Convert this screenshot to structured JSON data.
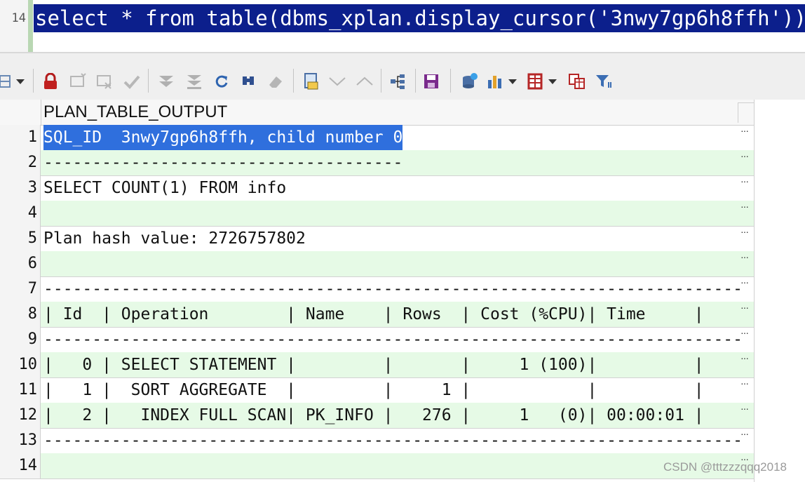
{
  "editor": {
    "line_number": "14",
    "sql": "select * from table(dbms_xplan.display_cursor('3nwy7gp6h8ffh'));"
  },
  "toolbar": {
    "icons": [
      "grid-settings-icon",
      "dropdown-arrow-icon",
      "lock-icon",
      "insert-row-icon",
      "delete-row-icon",
      "post-edit-icon",
      "fetch-next-icon",
      "fetch-all-icon",
      "refresh-icon",
      "find-icon",
      "clear-icon",
      "single-record-icon",
      "next-record-icon",
      "previous-record-icon",
      "query-tree-icon",
      "save-icon",
      "export-icon",
      "chart-icon",
      "dropdown-arrow-icon",
      "grid-view-icon",
      "dropdown-arrow-icon",
      "compare-icon",
      "filter-icon"
    ]
  },
  "grid": {
    "column_header": "PLAN_TABLE_OUTPUT",
    "rows": [
      {
        "num": "1",
        "text": "SQL_ID  3nwy7gp6h8ffh, child number 0"
      },
      {
        "num": "2",
        "text": "-------------------------------------"
      },
      {
        "num": "3",
        "text": "SELECT COUNT(1) FROM info"
      },
      {
        "num": "4",
        "text": ""
      },
      {
        "num": "5",
        "text": "Plan hash value: 2726757802"
      },
      {
        "num": "6",
        "text": ""
      },
      {
        "num": "7",
        "text": "------------------------------------------------------------------------"
      },
      {
        "num": "8",
        "text": "| Id  | Operation        | Name    | Rows  | Cost (%CPU)| Time     |"
      },
      {
        "num": "9",
        "text": "------------------------------------------------------------------------"
      },
      {
        "num": "10",
        "text": "|   0 | SELECT STATEMENT |         |       |     1 (100)|          |"
      },
      {
        "num": "11",
        "text": "|   1 |  SORT AGGREGATE  |         |     1 |            |          |"
      },
      {
        "num": "12",
        "text": "|   2 |   INDEX FULL SCAN| PK_INFO |   276 |     1   (0)| 00:00:01 |"
      },
      {
        "num": "13",
        "text": "------------------------------------------------------------------------"
      },
      {
        "num": "14",
        "text": ""
      }
    ],
    "more_button": "···"
  },
  "watermark": "CSDN @tttzzzqqq2018",
  "colors": {
    "editor_selection": "#0c1f8c",
    "cell_selection": "#2f6fdd",
    "alt_row": "#e6fae6",
    "gutter_mark": "#b9d7b3"
  }
}
